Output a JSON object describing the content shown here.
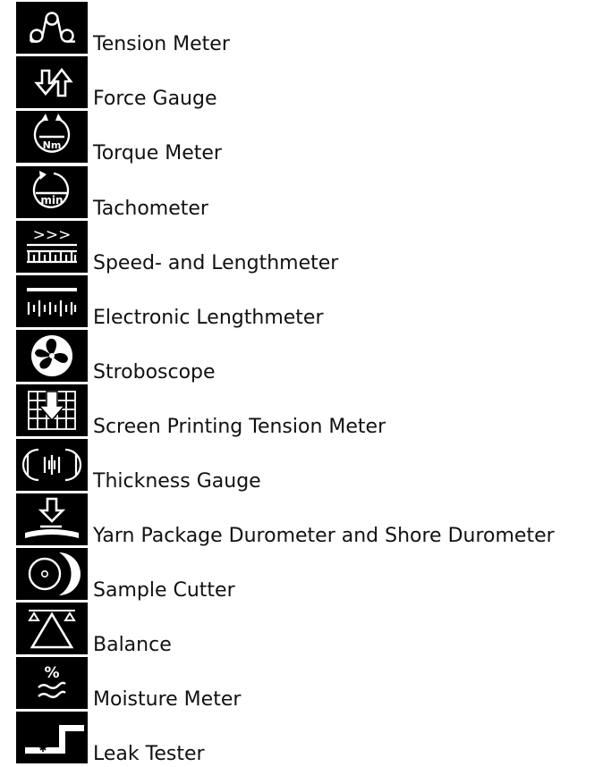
{
  "items": [
    {
      "label": "Tension Meter",
      "icon": "tension-meter-icon"
    },
    {
      "label": "Force Gauge",
      "icon": "force-gauge-icon"
    },
    {
      "label": "Torque Meter",
      "icon": "torque-meter-icon",
      "icon_text": "Nm"
    },
    {
      "label": "Tachometer",
      "icon": "tachometer-icon",
      "icon_text": "min"
    },
    {
      "label": "Speed- and Lengthmeter",
      "icon": "speed-lengthmeter-icon",
      "icon_text": ">>>"
    },
    {
      "label": "Electronic Lengthmeter",
      "icon": "electronic-lengthmeter-icon"
    },
    {
      "label": "Stroboscope",
      "icon": "stroboscope-icon"
    },
    {
      "label": "Screen Printing Tension Meter",
      "icon": "screen-printing-icon"
    },
    {
      "label": "Thickness Gauge",
      "icon": "thickness-gauge-icon"
    },
    {
      "label": "Yarn Package Durometer and Shore Durometer",
      "icon": "durometer-icon"
    },
    {
      "label": "Sample Cutter",
      "icon": "sample-cutter-icon"
    },
    {
      "label": "Balance",
      "icon": "balance-icon"
    },
    {
      "label": "Moisture Meter",
      "icon": "moisture-meter-icon",
      "icon_text": "%"
    },
    {
      "label": "Leak Tester",
      "icon": "leak-tester-icon"
    }
  ],
  "colors": {
    "icon_background": "#000000",
    "icon_foreground": "#ffffff",
    "label_text": "#111111"
  }
}
